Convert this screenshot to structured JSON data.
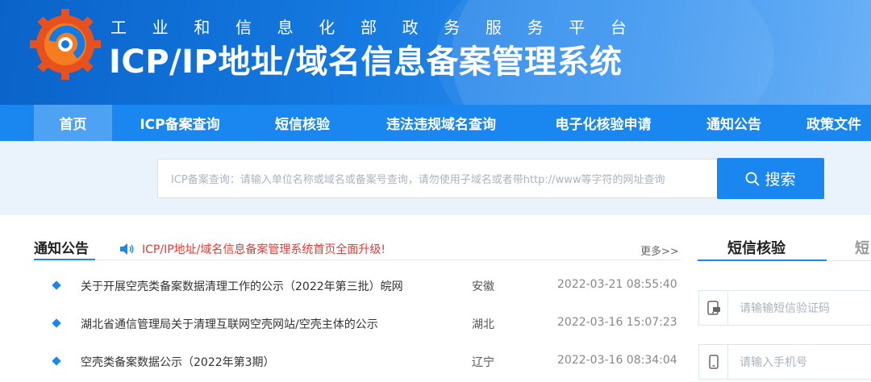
{
  "header": {
    "org_chars": [
      "工",
      "业",
      "和",
      "信",
      "息",
      "化",
      "部",
      "政",
      "务",
      "服",
      "务",
      "平",
      "台"
    ],
    "system_title": "ICP/IP地址/域名信息备案管理系统"
  },
  "nav": {
    "items": [
      {
        "label": "首页",
        "active": true
      },
      {
        "label": "ICP备案查询",
        "active": false
      },
      {
        "label": "短信核验",
        "active": false
      },
      {
        "label": "违法违规域名查询",
        "active": false
      },
      {
        "label": "电子化核验申请",
        "active": false
      },
      {
        "label": "通知公告",
        "active": false
      },
      {
        "label": "政策文件",
        "active": false
      }
    ]
  },
  "search": {
    "placeholder": "ICP备案查询：请输入单位名称或域名或备案号查询，请勿使用子域名或者带http://www等字符的网址查询",
    "button_label": "搜索"
  },
  "notices": {
    "title": "通知公告",
    "headline": "ICP/IP地址/域名信息备案管理系统首页全面升级!",
    "more_label": "更多>>",
    "rows": [
      {
        "title": "关于开展空壳类备案数据清理工作的公示（2022年第三批）皖网",
        "region": "安徽",
        "time": "2022-03-21 08:55:40"
      },
      {
        "title": "湖北省通信管理局关于清理互联网空壳网站/空壳主体的公示",
        "region": "湖北",
        "time": "2022-03-16 15:07:23"
      },
      {
        "title": "空壳类备案数据公示（2022年第3期）",
        "region": "辽宁",
        "time": "2022-03-16 08:34:04"
      }
    ]
  },
  "sms_panel": {
    "tab_active": "短信核验",
    "tab_next": "短",
    "code_placeholder": "请输输短信验证码",
    "phone_placeholder": "请输入手机号"
  },
  "colors": {
    "primary": "#1a86f0",
    "nav_active": "#4da2f3",
    "headline_red": "#e53935"
  }
}
